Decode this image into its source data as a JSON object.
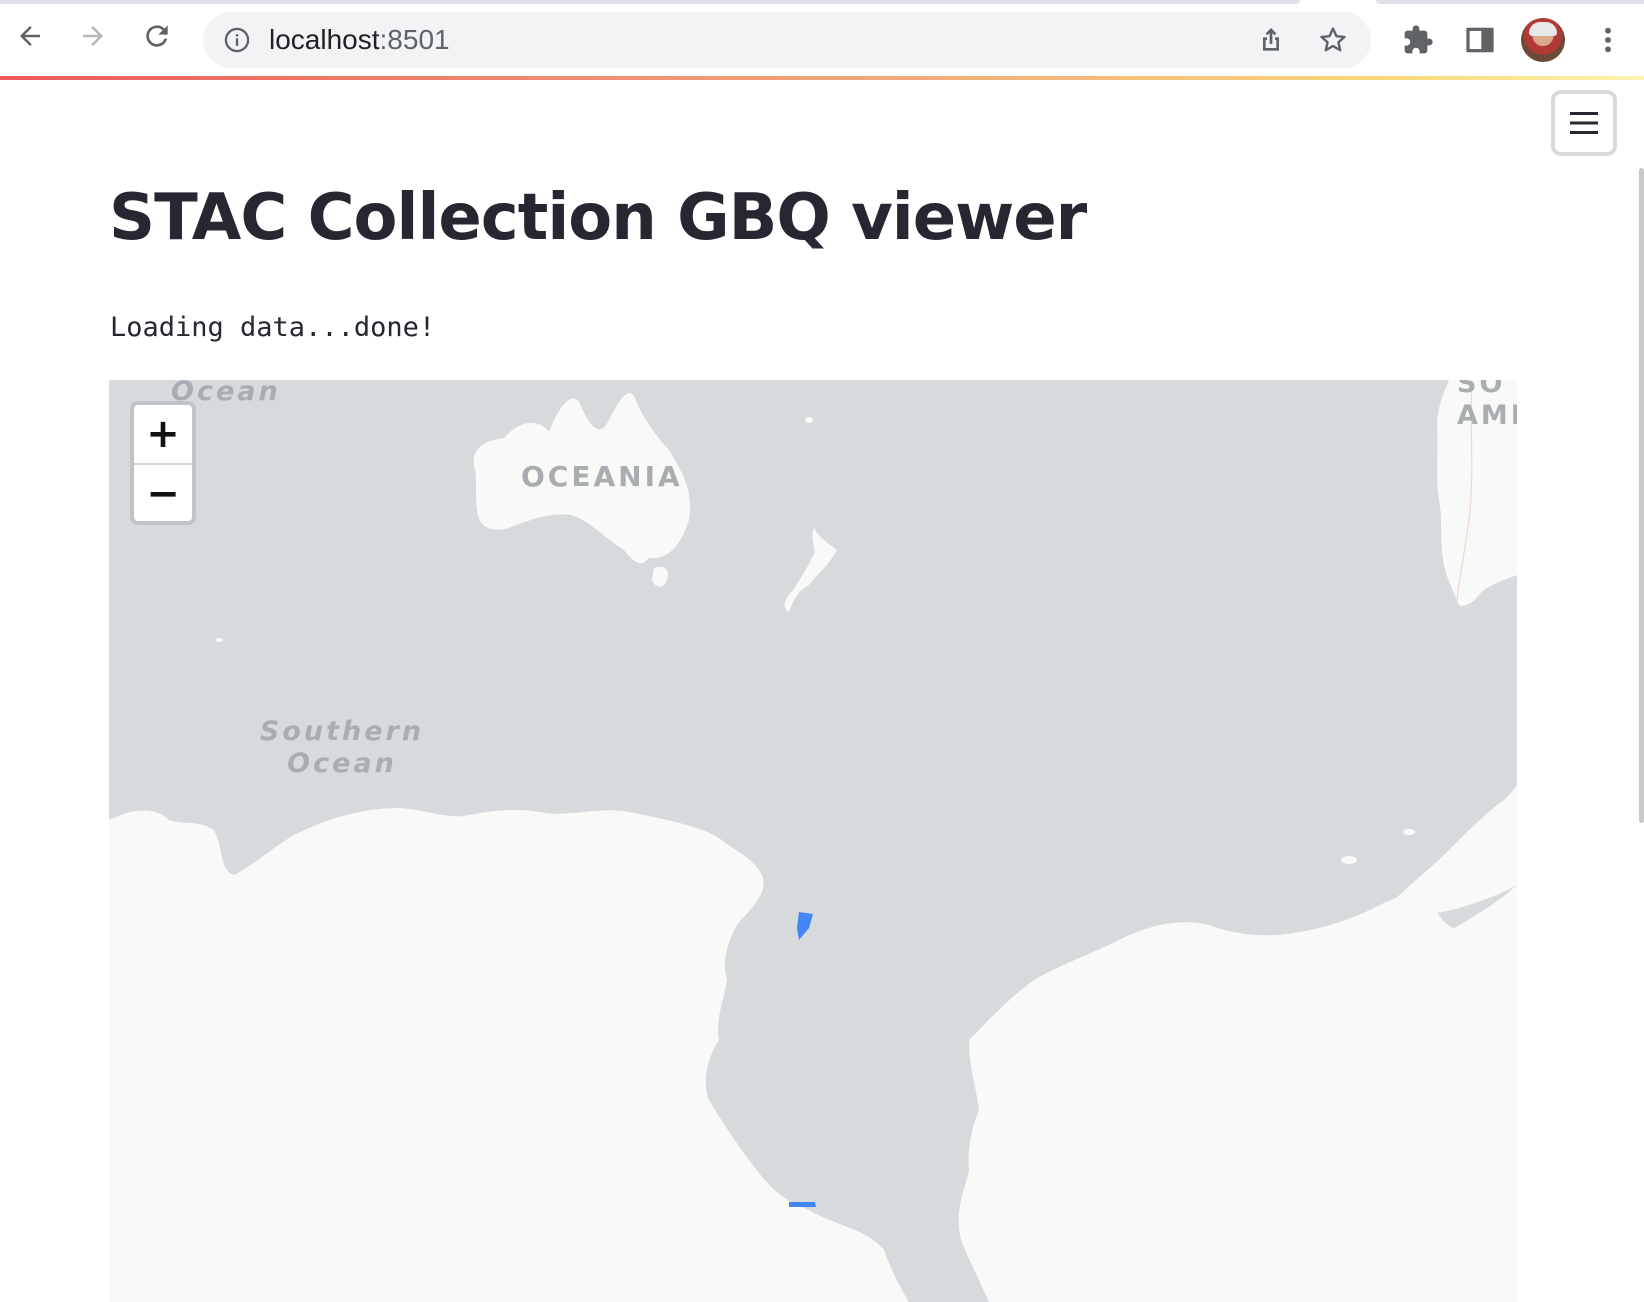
{
  "browser": {
    "url_host": "localhost",
    "url_port": ":8501",
    "icons": [
      "back-arrow-icon",
      "forward-arrow-icon",
      "reload-icon",
      "site-info-icon",
      "share-icon",
      "bookmark-star-icon",
      "extensions-puzzle-icon",
      "side-panel-icon",
      "profile-avatar",
      "more-menu-icon"
    ]
  },
  "app": {
    "title": "STAC Collection GBQ viewer",
    "status": "Loading data...done!",
    "menu_icon": "hamburger-menu-icon"
  },
  "map": {
    "labels": {
      "ocean_top": "Ocean",
      "oceania": "OCEANIA",
      "southern_ocean_line1": "Southern",
      "southern_ocean_line2": "Ocean",
      "south_america_line1": "SO",
      "south_america_line2": "AME"
    },
    "zoom_in_label": "+",
    "zoom_out_label": "−",
    "feature_color": "#4285f4",
    "land_color": "#f9f9f8",
    "water_color": "#d6dadd"
  }
}
